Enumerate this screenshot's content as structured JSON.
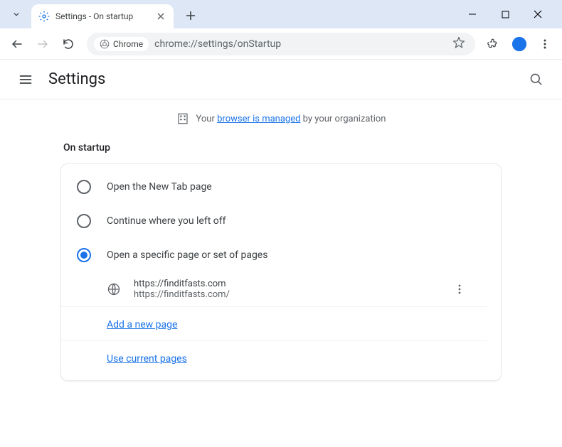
{
  "tab": {
    "title": "Settings - On startup"
  },
  "omnibox": {
    "chip_label": "Chrome",
    "url": "chrome://settings/onStartup"
  },
  "settings_header": {
    "title": "Settings"
  },
  "managed_banner": {
    "prefix": "Your ",
    "link_text": "browser is managed",
    "suffix": " by your organization"
  },
  "section": {
    "title": "On startup",
    "options": {
      "new_tab": "Open the New Tab page",
      "continue": "Continue where you left off",
      "specific": "Open a specific page or set of pages"
    },
    "pages": [
      {
        "title": "https://finditfasts.com",
        "url": "https://finditfasts.com/"
      }
    ],
    "add_new_page": "Add a new page",
    "use_current_pages": "Use current pages"
  }
}
